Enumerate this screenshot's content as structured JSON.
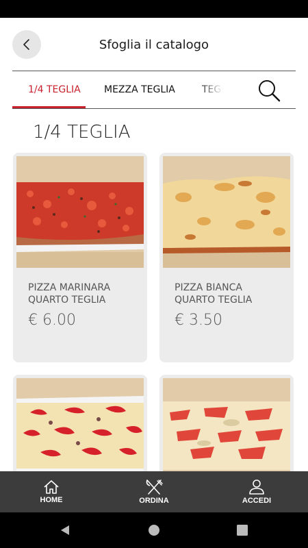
{
  "header": {
    "title": "Sfoglia il catalogo",
    "back_icon": "chevron-left-icon"
  },
  "tabs": [
    {
      "label": "1/4 TEGLIA",
      "active": true
    },
    {
      "label": "MEZZA TEGLIA",
      "active": false
    },
    {
      "label": "TEGLIA",
      "active": false
    }
  ],
  "search_icon": "search-icon",
  "section": {
    "title": "1/4 TEGLIA"
  },
  "products": [
    {
      "name": "PIZZA MARINARA QUARTO TEGLIA",
      "price": "€ 6.00"
    },
    {
      "name": "PIZZA BIANCA QUARTO TEGLIA",
      "price": "€ 3.50"
    },
    {
      "name": "",
      "price": ""
    },
    {
      "name": "",
      "price": ""
    }
  ],
  "bottom_nav": [
    {
      "label": "HOME",
      "icon": "home-icon"
    },
    {
      "label": "ORDINA",
      "icon": "fork-knife-icon"
    },
    {
      "label": "ACCEDI",
      "icon": "user-icon"
    }
  ],
  "system_nav": [
    "back-triangle-icon",
    "home-circle-icon",
    "recents-square-icon"
  ],
  "colors": {
    "accent": "#c8202c",
    "nav_bg": "#3c3c3c",
    "card_bg": "#ececec"
  }
}
